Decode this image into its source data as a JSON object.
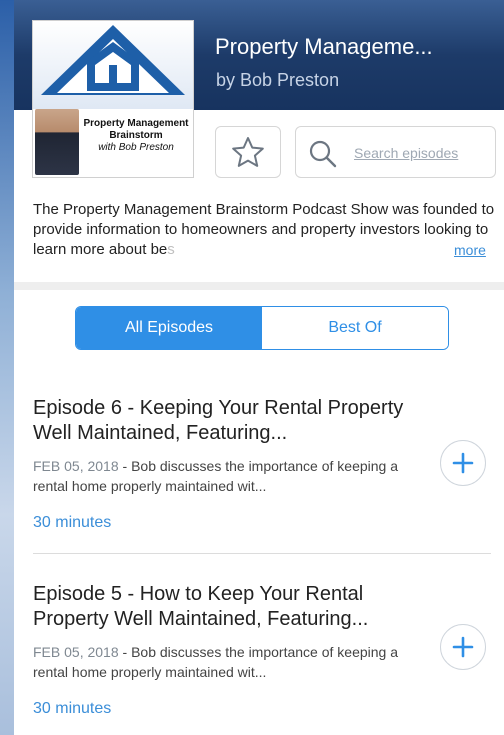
{
  "header": {
    "title": "Property Manageme...",
    "author": "by Bob Preston",
    "artwork": {
      "line1": "Property Management",
      "line2": "Brainstorm",
      "line3": "with Bob Preston"
    }
  },
  "actions": {
    "favorite_icon": "star-icon",
    "search_placeholder": "Search episodes",
    "search_icon": "search-icon"
  },
  "description": {
    "text": "The Property Management Brainstorm Podcast Show was founded to provide information to homeowners and property investors looking to learn more about be",
    "faded_tail": "s",
    "more_label": "more"
  },
  "tabs": [
    {
      "label": "All Episodes",
      "active": true
    },
    {
      "label": "Best Of",
      "active": false
    }
  ],
  "episodes": [
    {
      "title": "Episode 6 - Keeping Your Rental Property Well Maintained, Featuring...",
      "date": "FEB 05, 2018",
      "summary": " - Bob discusses the importance of keeping a rental home properly maintained wit...",
      "duration": "30 minutes"
    },
    {
      "title": "Episode 5 - How to Keep Your Rental Property Well Maintained, Featuring...",
      "date": "FEB 05, 2018",
      "summary": " - Bob discusses the importance of keeping a rental home properly maintained wit...",
      "duration": "30 minutes"
    }
  ],
  "colors": {
    "accent": "#2f8fe6",
    "link": "#3b8ed8",
    "header_bg": "#1d3b69"
  }
}
